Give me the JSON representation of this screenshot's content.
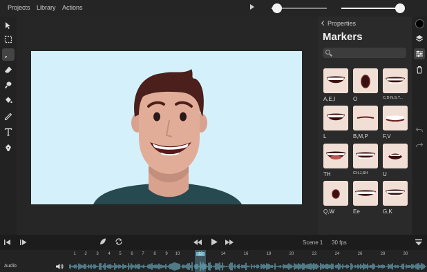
{
  "menu": {
    "projects": "Projects",
    "library": "Library",
    "actions": "Actions"
  },
  "playback": {
    "progress": 0.08,
    "zoom": 1.0
  },
  "panel": {
    "back_label": "Properties",
    "title": "Markers",
    "search_placeholder": "",
    "markers": [
      {
        "label": "A,E,I",
        "mouth": "open-teeth"
      },
      {
        "label": "O",
        "mouth": "round"
      },
      {
        "label": "C,D,N,S,T...",
        "mouth": "teeth-wide",
        "small": true
      },
      {
        "label": "L",
        "mouth": "open-teeth"
      },
      {
        "label": "B,M,P",
        "mouth": "closed"
      },
      {
        "label": "F,V",
        "mouth": "bite-lip"
      },
      {
        "label": "TH",
        "mouth": "tongue"
      },
      {
        "label": "CH,J,SH",
        "mouth": "teeth-wide",
        "small": true
      },
      {
        "label": "U",
        "mouth": "pucker"
      },
      {
        "label": "Q,W",
        "mouth": "small-round"
      },
      {
        "label": "Ee",
        "mouth": "grin"
      },
      {
        "label": "G,K",
        "mouth": "teeth-wide"
      }
    ]
  },
  "transport": {
    "scene": "Scene 1",
    "fps": "30 fps"
  },
  "timeline": {
    "ticks": [
      "1",
      "2",
      "3",
      "4",
      "5",
      "6",
      "7",
      "8",
      "9",
      "10",
      "12",
      "14",
      "16",
      "18",
      "20",
      "22",
      "24",
      "26",
      "28",
      "30"
    ],
    "current": "12",
    "audio_label": "Audio"
  },
  "colors": {
    "stage": "#d4f1fb",
    "accent": "#6fb3c8"
  }
}
